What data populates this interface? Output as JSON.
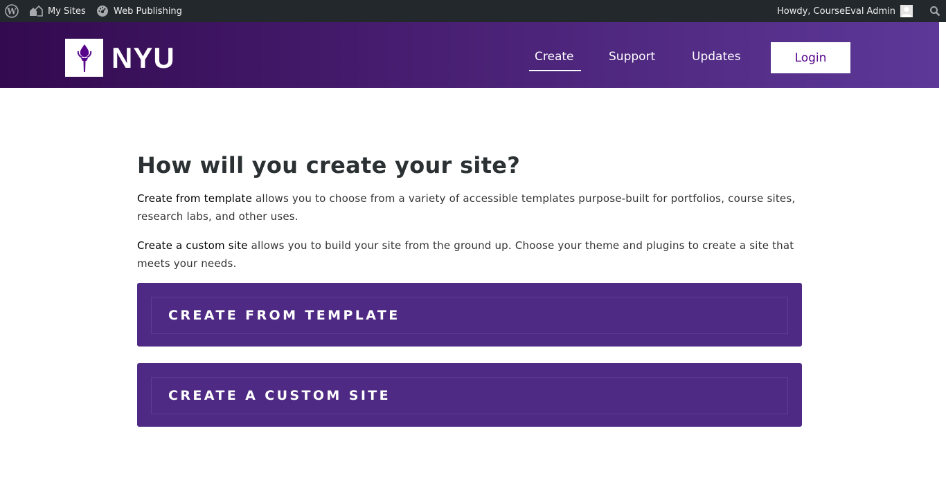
{
  "admin_bar": {
    "wp_icon": "wordpress-logo-icon",
    "my_sites_label": "My Sites",
    "my_sites_icon": "sites-icon",
    "site_label": "Web Publishing",
    "site_icon": "dashboard-icon",
    "greeting": "Howdy, CourseEval Admin",
    "search_icon": "search-icon"
  },
  "header": {
    "logo_text": "NYU",
    "logo_icon": "torch-icon",
    "nav": [
      {
        "label": "Create",
        "active": true
      },
      {
        "label": "Support"
      },
      {
        "label": "Updates"
      }
    ],
    "login_label": "Login"
  },
  "main": {
    "heading": "How will you create your site?",
    "p1_strong": "Create from template",
    "p1_rest": " allows you to choose from a variety of accessible templates purpose-built for portfolios, course sites, research labs, and other uses.",
    "p2_strong": "Create a custom site",
    "p2_rest": " allows you to build your site from the ground up. Choose your theme and plugins to create a site that meets your needs.",
    "cta_template": "CREATE FROM TEMPLATE",
    "cta_custom": "CREATE A CUSTOM SITE"
  },
  "colors": {
    "brand_purple": "#57068c",
    "cta_purple": "#4f2a84",
    "admin_bar_bg": "#23282d"
  }
}
